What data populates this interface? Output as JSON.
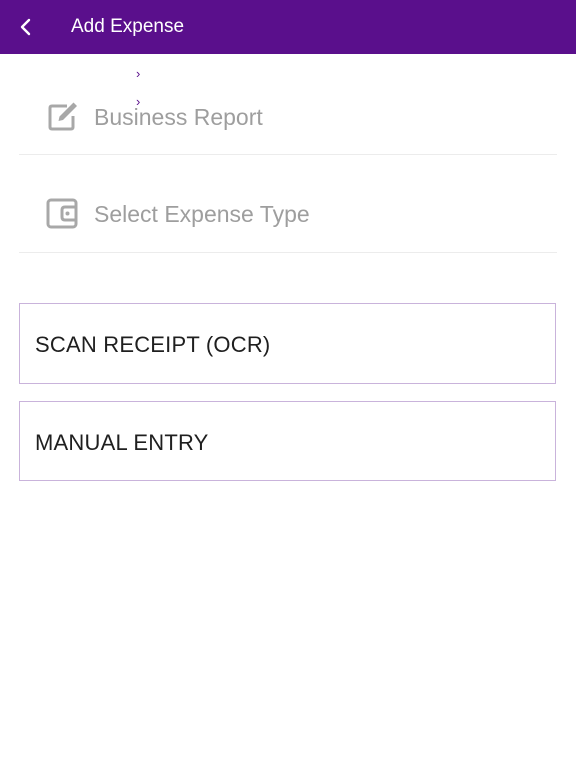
{
  "header": {
    "title": "Add Expense",
    "back_icon": "chevron-left-icon",
    "background_color": "#5a0f8c"
  },
  "decor": {
    "chevron_1": "›",
    "chevron_2": "›"
  },
  "form": {
    "business_report": {
      "placeholder": "Business Report",
      "icon": "edit-icon"
    },
    "expense_type": {
      "placeholder": "Select Expense Type",
      "icon": "wallet-icon"
    },
    "placeholder_color": "#9e9e9e"
  },
  "actions": {
    "scan_receipt": "SCAN RECEIPT (OCR)",
    "manual_entry": "MANUAL ENTRY",
    "border_color": "#c9b3db"
  }
}
